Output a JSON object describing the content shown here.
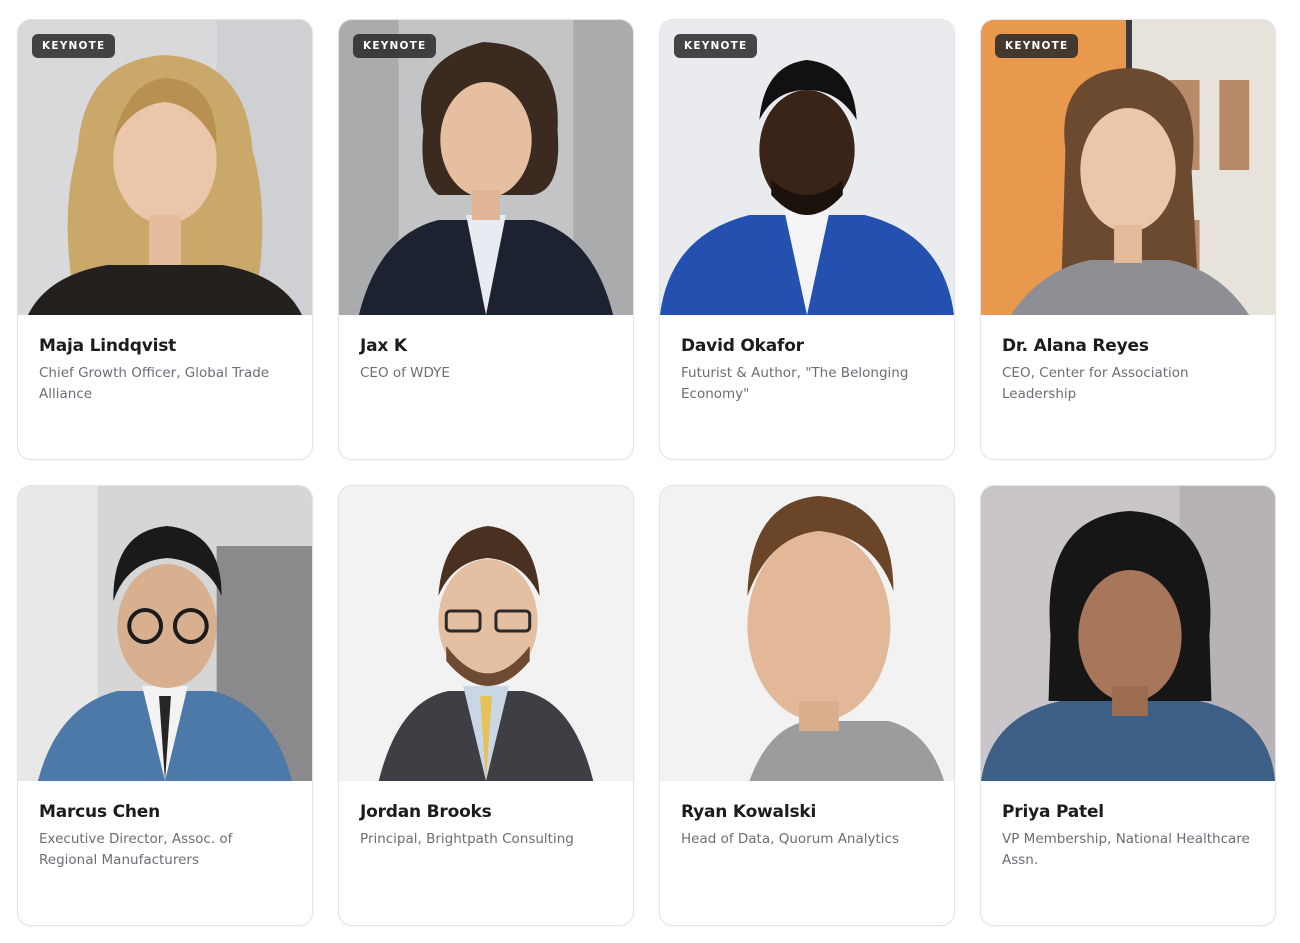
{
  "badge_label": "KEYNOTE",
  "speakers": [
    {
      "name": "Maja Lindqvist",
      "title": "Chief Growth Officer, Global Trade Alliance",
      "keynote": true
    },
    {
      "name": "Jax K",
      "title": "CEO of WDYE",
      "keynote": true
    },
    {
      "name": "David Okafor",
      "title": "Futurist & Author, \"The Belonging Economy\"",
      "keynote": true
    },
    {
      "name": "Dr. Alana Reyes",
      "title": "CEO, Center for Association Leadership",
      "keynote": true
    },
    {
      "name": "Marcus Chen",
      "title": "Executive Director, Assoc. of Regional Manufacturers",
      "keynote": false
    },
    {
      "name": "Jordan Brooks",
      "title": "Principal, Brightpath Consulting",
      "keynote": false
    },
    {
      "name": "Ryan Kowalski",
      "title": "Head of Data, Quorum Analytics",
      "keynote": false
    },
    {
      "name": "Priya Patel",
      "title": "VP Membership, National Healthcare Assn.",
      "keynote": false
    }
  ]
}
